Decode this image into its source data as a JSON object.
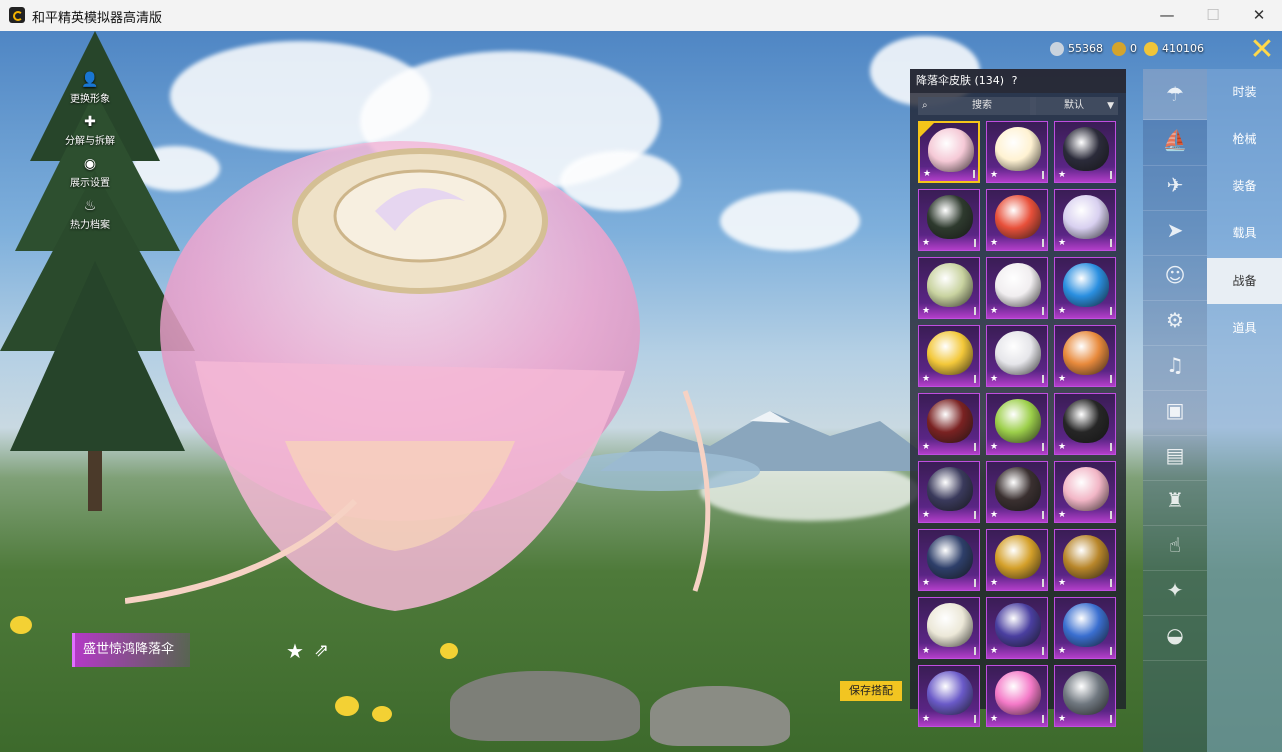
{
  "window": {
    "title": "和平精英模拟器高清版",
    "controls": {
      "minimize": "—",
      "maximize": "☐",
      "close": "✕"
    }
  },
  "left_menu": [
    {
      "icon": "person-swap-icon",
      "label": "更换形象"
    },
    {
      "icon": "puzzle-icon",
      "label": "分解与拆解"
    },
    {
      "icon": "eye-icon",
      "label": "展示设置"
    },
    {
      "icon": "flame-icon",
      "label": "热力档案"
    }
  ],
  "currencies": [
    {
      "icon": "silver-coin-icon",
      "value": "55368",
      "color": "#c9d3de"
    },
    {
      "icon": "gold-medal-icon",
      "value": "0",
      "color": "#d4a42c"
    },
    {
      "icon": "gold-coin-icon",
      "value": "410106",
      "color": "#f0c53a"
    }
  ],
  "skin_panel": {
    "title": "降落伞皮肤 (134)",
    "search_label": "搜索",
    "sort_label": "默认",
    "tiles": [
      {
        "art": "#f5c9d6",
        "selected": true
      },
      {
        "art": "#fff2d2",
        "selected": false
      },
      {
        "art": "#2b2b3a",
        "selected": false
      },
      {
        "art": "#2e3a2e",
        "selected": false
      },
      {
        "art": "#e8503a",
        "selected": false
      },
      {
        "art": "#d8d0f0",
        "selected": false
      },
      {
        "art": "#c9d3a0",
        "selected": false
      },
      {
        "art": "#f1eef0",
        "selected": false
      },
      {
        "art": "#2a8fe0",
        "selected": false
      },
      {
        "art": "#f3c83a",
        "selected": false
      },
      {
        "art": "#e6e6ea",
        "selected": false
      },
      {
        "art": "#e88a3c",
        "selected": false
      },
      {
        "art": "#7a2222",
        "selected": false
      },
      {
        "art": "#9ccf4a",
        "selected": false
      },
      {
        "art": "#262626",
        "selected": false
      },
      {
        "art": "#3a3a5c",
        "selected": false
      },
      {
        "art": "#3a3030",
        "selected": false
      },
      {
        "art": "#f2b6c6",
        "selected": false
      },
      {
        "art": "#2e3f6a",
        "selected": false
      },
      {
        "art": "#d4a02a",
        "selected": false
      },
      {
        "art": "#b8862a",
        "selected": false
      },
      {
        "art": "#ece8d8",
        "selected": false
      },
      {
        "art": "#4a3fa0",
        "selected": false
      },
      {
        "art": "#3a6fd0",
        "selected": false
      },
      {
        "art": "#6a5ac8",
        "selected": false
      },
      {
        "art": "#f47ac8",
        "selected": false
      },
      {
        "art": "#707880",
        "selected": false
      }
    ]
  },
  "sub_categories": [
    {
      "icon": "parachute-icon",
      "active": true
    },
    {
      "icon": "glider-icon",
      "active": false
    },
    {
      "icon": "drone-icon",
      "active": false
    },
    {
      "icon": "plane-icon",
      "active": false
    },
    {
      "icon": "face-icon",
      "active": false
    },
    {
      "icon": "robot-icon",
      "active": false
    },
    {
      "icon": "speaker-icon",
      "active": false
    },
    {
      "icon": "card-icon",
      "active": false
    },
    {
      "icon": "picture-icon",
      "active": false
    },
    {
      "icon": "extinguisher-icon",
      "active": false
    },
    {
      "icon": "hand-icon",
      "active": false
    },
    {
      "icon": "wand-icon",
      "active": false
    },
    {
      "icon": "hat-icon",
      "active": false
    }
  ],
  "categories": [
    {
      "label": "时装",
      "active": false
    },
    {
      "label": "枪械",
      "active": false
    },
    {
      "label": "装备",
      "active": false
    },
    {
      "label": "载具",
      "active": false
    },
    {
      "label": "战备",
      "active": true
    },
    {
      "label": "道具",
      "active": false
    }
  ],
  "selected_item": {
    "name": "盛世惊鸿降落伞"
  },
  "actions": {
    "favorite_icon": "star-icon",
    "share_icon": "share-icon",
    "save_label": "保存搭配"
  }
}
